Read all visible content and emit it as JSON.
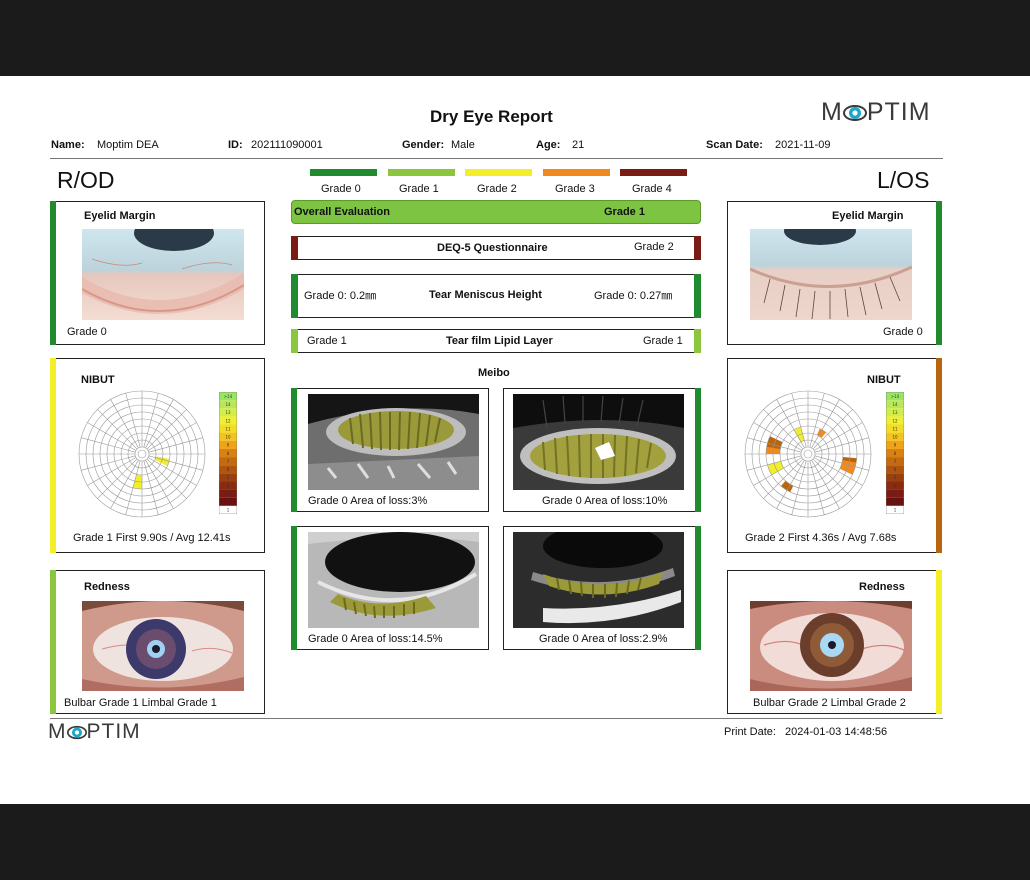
{
  "report": {
    "title": "Dry Eye Report",
    "brand": "MOPTIM",
    "print_date_label": "Print Date:",
    "print_date": "2024-01-03 14:48:56"
  },
  "patient": {
    "name_label": "Name:",
    "name": "Moptim DEA",
    "id_label": "ID:",
    "id": "202111090001",
    "gender_label": "Gender:",
    "gender": "Male",
    "age_label": "Age:",
    "age": "21",
    "scan_date_label": "Scan Date:",
    "scan_date": "2021-11-09"
  },
  "sides": {
    "right": "R/OD",
    "left": "L/OS"
  },
  "grade_legend": [
    {
      "label": "Grade 0",
      "color": "#1f8a2e"
    },
    {
      "label": "Grade 1",
      "color": "#8cc63f"
    },
    {
      "label": "Grade 2",
      "color": "#f2ee2a"
    },
    {
      "label": "Grade 3",
      "color": "#f08a1e"
    },
    {
      "label": "Grade 4",
      "color": "#7a1c14"
    }
  ],
  "right": {
    "eyelid": {
      "title": "Eyelid Margin",
      "grade": "Grade 0",
      "color": "#1f8a2e"
    },
    "nibut": {
      "title": "NIBUT",
      "summary": "Grade 1   First 9.90s / Avg 12.41s",
      "color": "#f2ee2a"
    },
    "redness": {
      "title": "Redness",
      "summary": "Bulbar Grade 1    Limbal Grade 1",
      "color": "#8cc63f"
    }
  },
  "left": {
    "eyelid": {
      "title": "Eyelid Margin",
      "grade": "Grade 0",
      "color": "#1f8a2e"
    },
    "nibut": {
      "title": "NIBUT",
      "summary": "Grade 2   First 4.36s / Avg 7.68s",
      "color": "#b8650f"
    },
    "redness": {
      "title": "Redness",
      "summary": "Bulbar Grade 2    Limbal Grade 2",
      "color": "#f2ee2a"
    }
  },
  "nibut_scale_labels": [
    ">14",
    "14",
    "13",
    "12",
    "11",
    "10",
    "9",
    "8",
    "7",
    "6",
    "5",
    "4",
    "3",
    "2",
    "1"
  ],
  "center": {
    "overall": {
      "label": "Overall Evaluation",
      "grade": "Grade 1"
    },
    "deq5": {
      "label": "DEQ-5 Questionnaire",
      "grade": "Grade 2"
    },
    "meniscus": {
      "label": "Tear Meniscus Height",
      "right": "Grade 0:  0.2㎜",
      "left": "Grade 0:  0.27㎜"
    },
    "lipid": {
      "label": "Tear film Lipid Layer",
      "right": "Grade 1",
      "left": "Grade 1"
    },
    "meibo_title": "Meibo",
    "meibo": [
      {
        "caption": "Grade 0   Area of loss:3%"
      },
      {
        "caption": "Grade 0   Area of loss:10%"
      },
      {
        "caption": "Grade 0   Area of loss:14.5%"
      },
      {
        "caption": "Grade 0   Area of loss:2.9%"
      }
    ]
  }
}
